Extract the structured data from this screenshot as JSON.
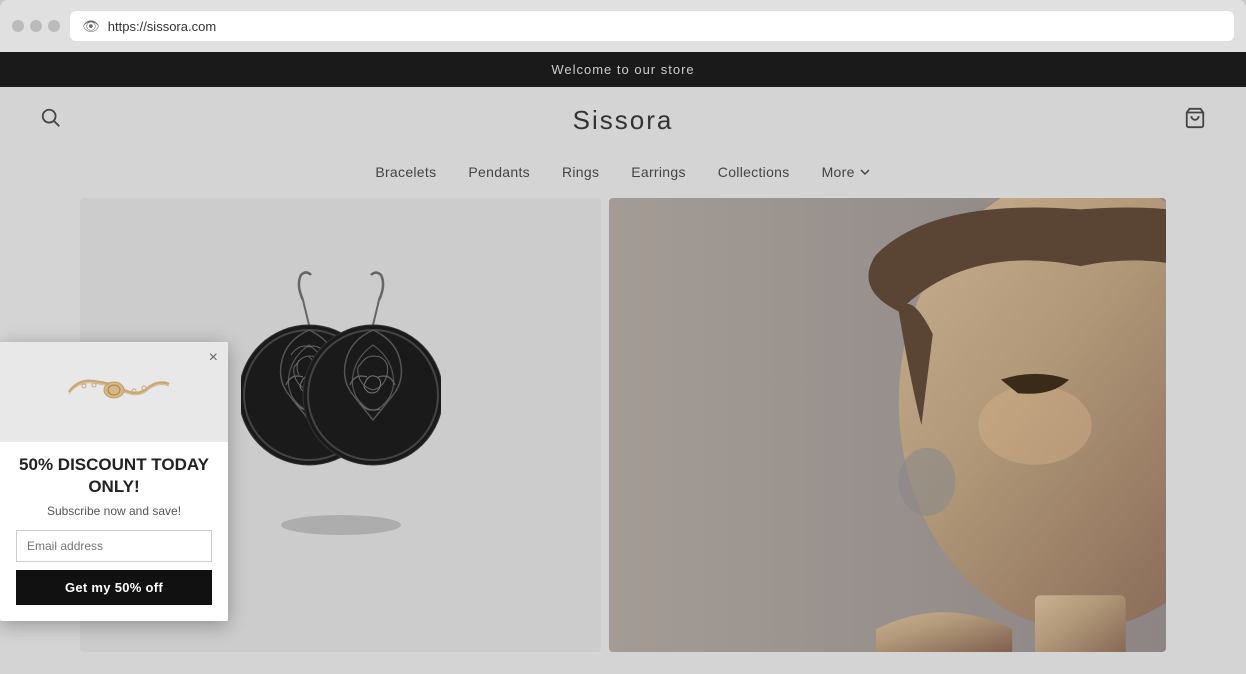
{
  "browser": {
    "url": "https://sissora.com",
    "dots": [
      "dot1",
      "dot2",
      "dot3"
    ]
  },
  "announcement": {
    "text": "Welcome to our store"
  },
  "header": {
    "logo": "Sissora",
    "search_label": "Search",
    "cart_label": "Cart"
  },
  "nav": {
    "items": [
      {
        "label": "Bracelets",
        "id": "bracelets"
      },
      {
        "label": "Pendants",
        "id": "pendants"
      },
      {
        "label": "Rings",
        "id": "rings"
      },
      {
        "label": "Earrings",
        "id": "earrings"
      },
      {
        "label": "Collections",
        "id": "collections"
      },
      {
        "label": "More",
        "id": "more"
      }
    ]
  },
  "popup": {
    "title": "50% DISCOUNT TODAY ONLY!",
    "subtitle": "Subscribe now and save!",
    "email_placeholder": "Email address",
    "button_label": "Get my 50% off",
    "close_label": "×"
  }
}
